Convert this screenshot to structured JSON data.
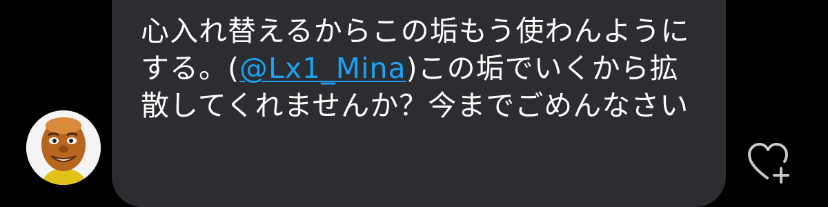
{
  "message": {
    "text_before": "心入れ替えるからこの垢もう使わんようにする。(",
    "mention": "@Lx1_Mina",
    "text_after": ")この垢でいくから拡散してくれませんか？今までごめんなさい"
  },
  "avatar": {
    "icon": "user-avatar"
  },
  "reaction": {
    "icon": "heart-plus-icon"
  },
  "colors": {
    "background": "#000000",
    "bubble": "#2b2d31",
    "text": "#ffffff",
    "mention": "#1da1f2",
    "icon": "#c8c8c8"
  }
}
